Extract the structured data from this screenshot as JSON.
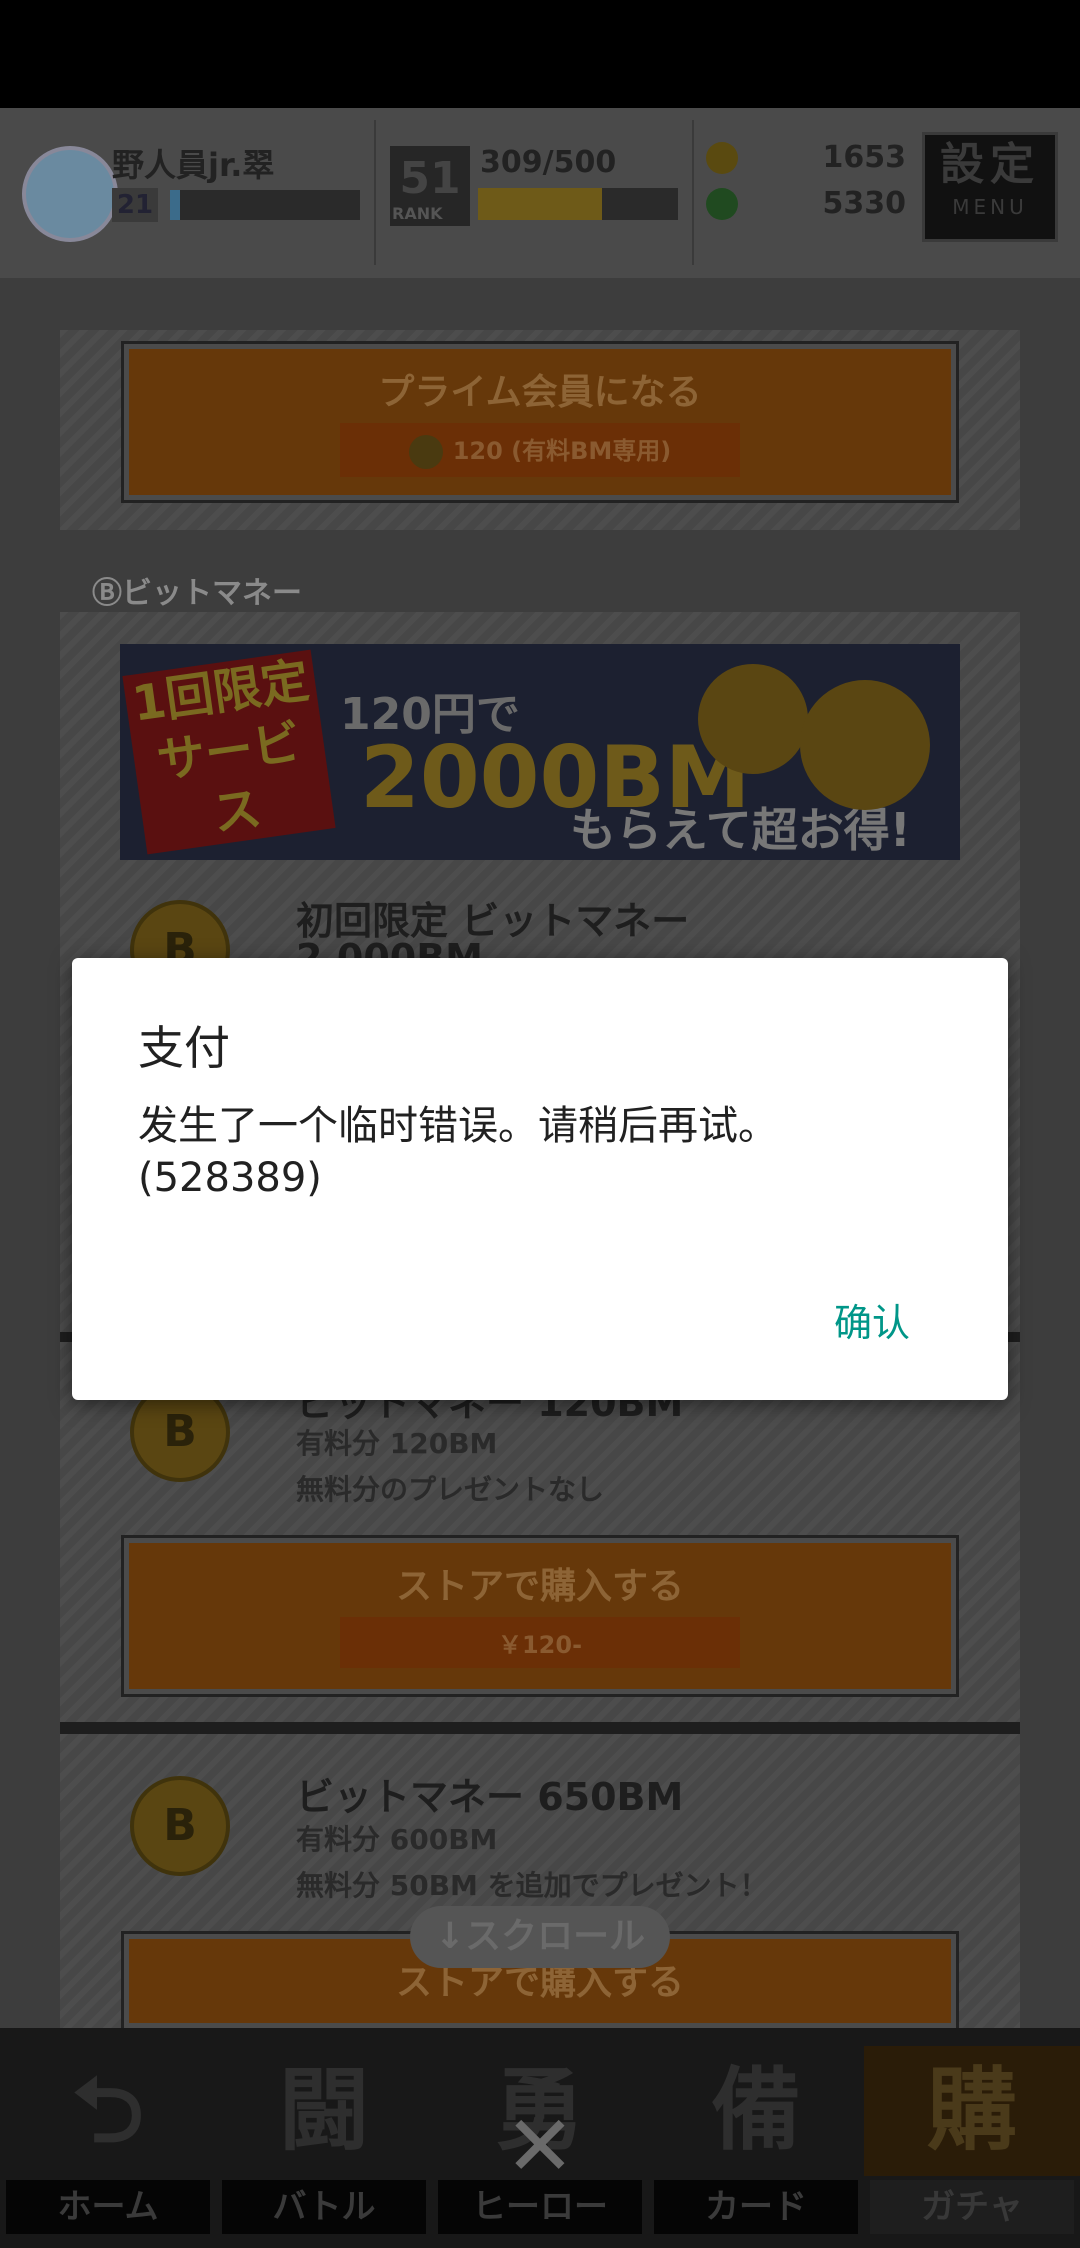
{
  "header": {
    "player_name": "野人員jr.翠",
    "player_level": "21",
    "rank_value": "51",
    "rank_label": "RANK",
    "stamina": "309/500",
    "stamina_fraction": 0.62,
    "exp_fraction": 0.05,
    "currency_top": "1653",
    "currency_bottom": "5330",
    "menu_big": "設定",
    "menu_small": "MENU"
  },
  "prime": {
    "button_label": "プライム会員になる",
    "price_text": "120 (有料BM専用)"
  },
  "section_label": "Ⓑビットマネー",
  "banner": {
    "limited": "1回限定サービス",
    "price_line": "120円で",
    "amount": "2000BM",
    "tagline": "もらえて超お得!"
  },
  "products": [
    {
      "title": "初回限定 ビットマネー",
      "title2": "2,000BM"
    },
    {
      "title": "ビットマネー 120BM",
      "paid": "有料分 120BM",
      "free": "無料分のプレゼントなし",
      "button_label": "ストアで購入する",
      "price": "￥120-"
    },
    {
      "title": "ビットマネー 650BM",
      "paid": "有料分 600BM",
      "free": "無料分 50BM を追加でプレゼント！",
      "button_label": "ストアで購入する"
    }
  ],
  "scroll_hint": "↓スクロール",
  "nav": [
    {
      "label": "ホーム",
      "icon": "⮌"
    },
    {
      "label": "バトル",
      "icon": "闘"
    },
    {
      "label": "ヒーロー",
      "icon": "勇"
    },
    {
      "label": "カード",
      "icon": "備"
    },
    {
      "label": "ガチャ",
      "icon": "購"
    }
  ],
  "close_glyph": "✕",
  "dialog": {
    "title": "支付",
    "message": "发生了一个临时错误。请稍后再试。(528389)",
    "confirm": "确认"
  }
}
